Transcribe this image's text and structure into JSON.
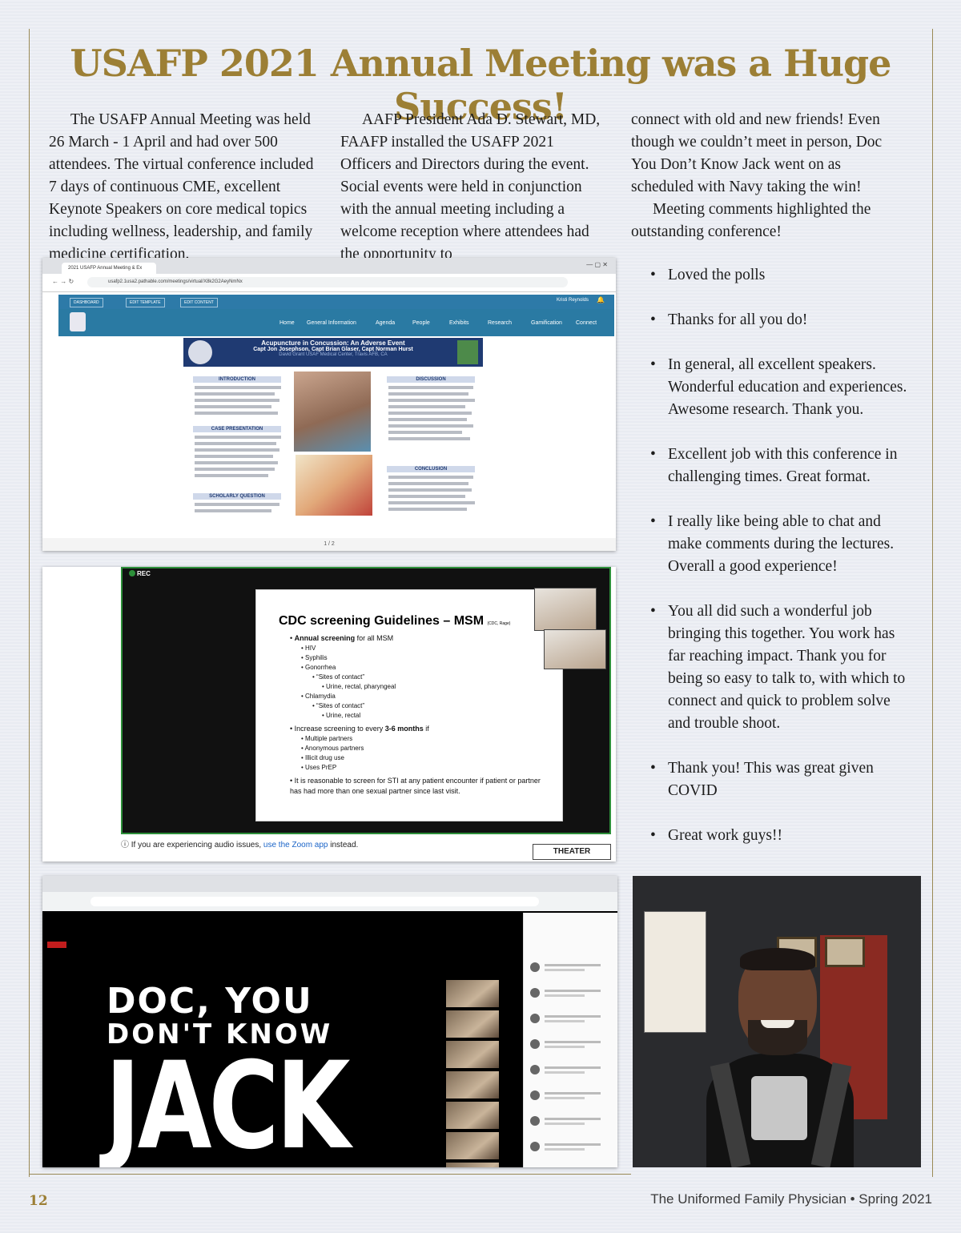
{
  "title": "USAFP 2021 Annual Meeting was a Huge Success!",
  "column1": "The USAFP Annual Meeting was held 26 March - 1 April and had over 500 attendees. The virtual conference included 7 days of continuous CME, excellent Keynote Speakers on core medical topics including wellness, leadership, and family medicine certification.",
  "column2": "AAFP President Ada D. Stewart, MD, FAAFP installed the USAFP 2021 Officers and Directors during the event. Social events were held in conjunction with the annual meeting including a welcome reception where attendees had the opportunity to",
  "column3a": "connect with old and new friends! Even though we couldn’t meet in person, Doc You Don’t Know Jack went on as scheduled with Navy taking the win!",
  "column3b": "Meeting comments highlighted the outstanding conference!",
  "comments": [
    "Loved the polls",
    "Thanks for all you do!",
    "In general, all excellent speakers. Wonderful education and experiences. Awesome research. Thank you.",
    "Excellent job with this conference in challenging times. Great format.",
    "I really like being able to chat and make comments during the lectures. Overall a good experience!",
    "You all did such a wonderful job bringing this together. You work has far reaching impact. Thank you for being so easy to talk to, with which to connect and quick to problem solve and trouble shoot.",
    "Thank you! This was great given COVID",
    "Great work guys!!"
  ],
  "screenshot1": {
    "tab_title": "2021 USAFP Annual Meeting & Ex",
    "url": "usafp2.1usa2.pathable.com/meetings/virtual/X8k2G2AeyNmNx",
    "admin_buttons": [
      "DASHBOARD",
      "EDIT TEMPLATE",
      "EDIT CONTENT"
    ],
    "user": "Kristi Reynolds",
    "nav": [
      "Home",
      "General Information",
      "Agenda",
      "People",
      "Exhibits",
      "Research",
      "Gamification",
      "Connect"
    ],
    "poster_title": "Acupuncture in Concussion: An Adverse Event",
    "poster_authors": "Capt Jon Josephson, Capt Brian Glaser, Capt Norman Hurst",
    "poster_affiliation": "David Grant USAF Medical Center, Travis AFB, CA",
    "sections": [
      "INTRODUCTION",
      "CASE PRESENTATION",
      "SCHOLARLY QUESTION",
      "DISCUSSION",
      "CONCLUSION"
    ],
    "pager": "1 / 2"
  },
  "screenshot2": {
    "rec": "REC",
    "slide_title": "CDC screening Guidelines – MSM",
    "slide_note": "(CDC, Rage)",
    "annual_a": "Annual screening",
    "annual_b": " for all MSM",
    "items_annual": [
      "HIV",
      "Syphilis",
      "Gonorrhea"
    ],
    "sites_contact": "“Sites of contact”",
    "gon_sites": "Urine, rectal, pharyngeal",
    "chlamydia": "Chlamydia",
    "chl_sites": "Urine, rectal",
    "increase_a": "Increase screening to every ",
    "increase_b": "3-6 months",
    "increase_c": " if",
    "items_increase": [
      "Multiple partners",
      "Anonymous partners",
      "Illicit drug use",
      "Uses PrEP"
    ],
    "reasonable": "It is reasonable to screen for STI at any patient encounter if patient or partner has had more than one sexual partner since last visit.",
    "footer_a": "If you are experiencing audio issues, ",
    "footer_link": "use the Zoom app",
    "footer_b": " instead.",
    "theater": "THEATER"
  },
  "screenshot3": {
    "line1": "DOC, YOU",
    "line2": "DON'T KNOW",
    "line3": "JACK"
  },
  "page_number": "12",
  "footer": "The Uniformed Family Physician • Spring 2021"
}
